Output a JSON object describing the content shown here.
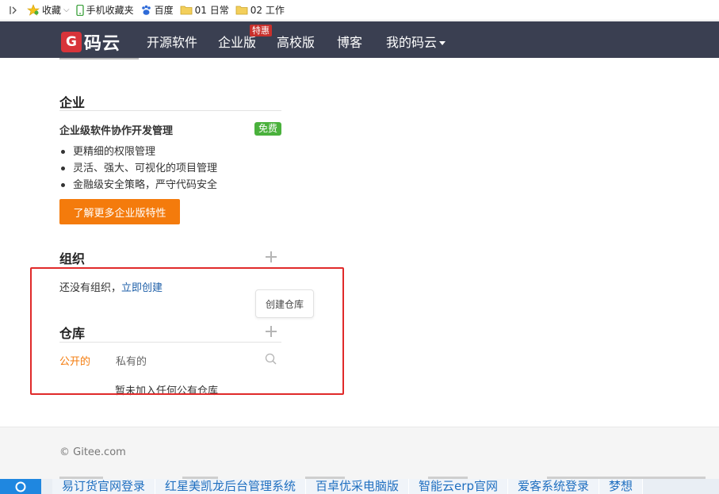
{
  "bookmarks": {
    "items": [
      {
        "label": "收藏",
        "icon": "star-icon",
        "has_caret": true
      },
      {
        "label": "手机收藏夹",
        "icon": "phone-icon"
      },
      {
        "label": "百度",
        "icon": "baidu-paw-icon"
      },
      {
        "label": "01 日常",
        "icon": "folder-icon"
      },
      {
        "label": "02 工作",
        "icon": "folder-icon"
      }
    ]
  },
  "navbar": {
    "logo_glyph": "G",
    "logo_text": "码云",
    "items": [
      "开源软件",
      "企业版",
      "高校版",
      "博客",
      "我的码云"
    ],
    "badge": "特惠",
    "bg_color": "#3a3f51"
  },
  "enterprise": {
    "title": "企业",
    "subtitle": "企业级软件协作开发管理",
    "badge": "免费",
    "features": [
      "更精细的权限管理",
      "灵活、强大、可视化的项目管理",
      "金融级安全策略，严守代码安全"
    ],
    "button": "了解更多企业版特性"
  },
  "orgs": {
    "title": "组织",
    "empty_text": "还没有组织，",
    "create_link": "立即创建"
  },
  "tooltip": "创建仓库",
  "repos": {
    "title": "仓库",
    "tabs": [
      "公开的",
      "私有的"
    ],
    "empty_text": "暂未加入任何公有仓库"
  },
  "footer": {
    "copyright": "© Gitee.com"
  },
  "taskbar": {
    "links": [
      "易订货官网登录",
      "红星美凯龙后台管理系统",
      "百卓优采电脑版",
      "智能云erp官网",
      "爱客系统登录",
      "梦想"
    ]
  },
  "colors": {
    "accent_orange": "#f47b0c",
    "free_green": "#4ab13c",
    "highlight_red": "#e02a2a",
    "link_blue": "#1e5fa8"
  }
}
